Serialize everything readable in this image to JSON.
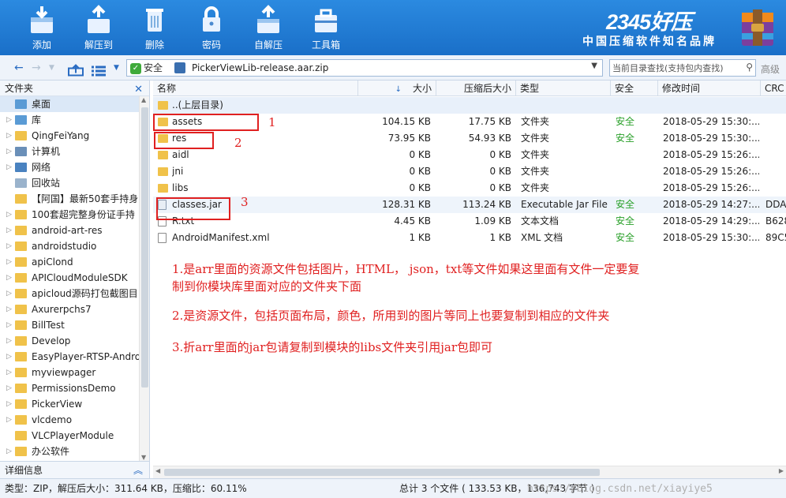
{
  "toolbar": {
    "buttons": [
      {
        "label": "添加"
      },
      {
        "label": "解压到"
      },
      {
        "label": "删除"
      },
      {
        "label": "密码"
      },
      {
        "label": "自解压"
      },
      {
        "label": "工具箱"
      }
    ],
    "brand_logo": "2345好压",
    "brand_slogan": "中国压缩软件知名品牌"
  },
  "address": {
    "safe_label": "安全",
    "path": "PickerViewLib-release.aar.zip",
    "search_placeholder": "当前目录查找(支持包内查找)",
    "advanced_label": "高级"
  },
  "sidebar": {
    "header": "文件夹",
    "items": [
      {
        "label": "桌面",
        "icon": "desktop-icon",
        "arrow": ""
      },
      {
        "label": "库",
        "icon": "library-icon",
        "arrow": "▷"
      },
      {
        "label": "QingFeiYang",
        "icon": "user-folder-icon",
        "arrow": "▷"
      },
      {
        "label": "计算机",
        "icon": "computer-icon",
        "arrow": "▷"
      },
      {
        "label": "网络",
        "icon": "network-icon",
        "arrow": "▷"
      },
      {
        "label": "回收站",
        "icon": "recycle-bin-icon",
        "arrow": ""
      },
      {
        "label": "【阿国】最新50套手持身",
        "icon": "folder-icon",
        "arrow": ""
      },
      {
        "label": "100套超完整身份证手持",
        "icon": "folder-icon",
        "arrow": "▷"
      },
      {
        "label": "android-art-res",
        "icon": "folder-icon",
        "arrow": "▷"
      },
      {
        "label": "androidstudio",
        "icon": "folder-icon",
        "arrow": "▷"
      },
      {
        "label": "apiClond",
        "icon": "folder-icon",
        "arrow": "▷"
      },
      {
        "label": "APICloudModuleSDK",
        "icon": "folder-icon",
        "arrow": "▷"
      },
      {
        "label": "apicloud源码打包截图目",
        "icon": "folder-icon",
        "arrow": "▷"
      },
      {
        "label": "Axurerpchs7",
        "icon": "folder-icon",
        "arrow": "▷"
      },
      {
        "label": "BillTest",
        "icon": "folder-icon",
        "arrow": "▷"
      },
      {
        "label": "Develop",
        "icon": "folder-icon",
        "arrow": "▷"
      },
      {
        "label": "EasyPlayer-RTSP-Andro",
        "icon": "folder-icon",
        "arrow": "▷"
      },
      {
        "label": "myviewpager",
        "icon": "folder-icon",
        "arrow": "▷"
      },
      {
        "label": "PermissionsDemo",
        "icon": "folder-icon",
        "arrow": "▷"
      },
      {
        "label": "PickerView",
        "icon": "folder-icon",
        "arrow": "▷"
      },
      {
        "label": "vlcdemo",
        "icon": "folder-icon",
        "arrow": "▷"
      },
      {
        "label": "VLCPlayerModule",
        "icon": "folder-icon",
        "arrow": ""
      },
      {
        "label": "办公软件",
        "icon": "folder-icon",
        "arrow": "▷"
      }
    ],
    "details_label": "详细信息"
  },
  "table": {
    "columns": [
      "名称",
      "大小",
      "压缩后大小",
      "类型",
      "安全",
      "修改时间",
      "CRC"
    ],
    "parent_label": "..(上层目录)",
    "rows": [
      {
        "name": "assets",
        "size": "104.15 KB",
        "packed": "17.75 KB",
        "type": "文件夹",
        "safe": "安全",
        "mtime": "2018-05-29 15:30:...",
        "crc": "",
        "icon": "folder"
      },
      {
        "name": "res",
        "size": "73.95 KB",
        "packed": "54.93 KB",
        "type": "文件夹",
        "safe": "安全",
        "mtime": "2018-05-29 15:30:...",
        "crc": "",
        "icon": "folder"
      },
      {
        "name": "aidl",
        "size": "0 KB",
        "packed": "0 KB",
        "type": "文件夹",
        "safe": "",
        "mtime": "2018-05-29 15:26:...",
        "crc": "",
        "icon": "folder"
      },
      {
        "name": "jni",
        "size": "0 KB",
        "packed": "0 KB",
        "type": "文件夹",
        "safe": "",
        "mtime": "2018-05-29 15:26:...",
        "crc": "",
        "icon": "folder"
      },
      {
        "name": "libs",
        "size": "0 KB",
        "packed": "0 KB",
        "type": "文件夹",
        "safe": "",
        "mtime": "2018-05-29 15:26:...",
        "crc": "",
        "icon": "folder"
      },
      {
        "name": "classes.jar",
        "size": "128.31 KB",
        "packed": "113.24 KB",
        "type": "Executable Jar File",
        "safe": "安全",
        "mtime": "2018-05-29 14:27:...",
        "crc": "DDA",
        "icon": "jar"
      },
      {
        "name": "R.txt",
        "size": "4.45 KB",
        "packed": "1.09 KB",
        "type": "文本文档",
        "safe": "安全",
        "mtime": "2018-05-29 14:29:...",
        "crc": "B628",
        "icon": "file"
      },
      {
        "name": "AndroidManifest.xml",
        "size": "1 KB",
        "packed": "1 KB",
        "type": "XML 文档",
        "safe": "安全",
        "mtime": "2018-05-29 15:30:...",
        "crc": "89C5",
        "icon": "file"
      }
    ]
  },
  "annotations": {
    "markers": [
      "1",
      "2",
      "3"
    ],
    "note1_line1": "1.是arr里面的资源文件包括图片，HTML， json，txt等文件如果这里面有文件一定要复",
    "note1_line2": "制到你模块库里面对应的文件夹下面",
    "note2": "2.是资源文件，包括页面布局，颜色，所用到的图片等同上也要复制到相应的文件夹",
    "note3": "3.折arr里面的jar包请复制到模块的libs文件夹引用jar包即可"
  },
  "status": {
    "left": "类型：ZIP，解压后大小：311.64 KB，压缩比：60.11%",
    "right": "总计 3 个文件 ( 133.53 KB，136,743 字节 )",
    "watermark": "https://blog.csdn.net/xiayiye5"
  },
  "colors": {
    "toolbar_blue": "#1f7ad4",
    "safe_green": "#2aa02a",
    "annotation_red": "#e02020"
  }
}
